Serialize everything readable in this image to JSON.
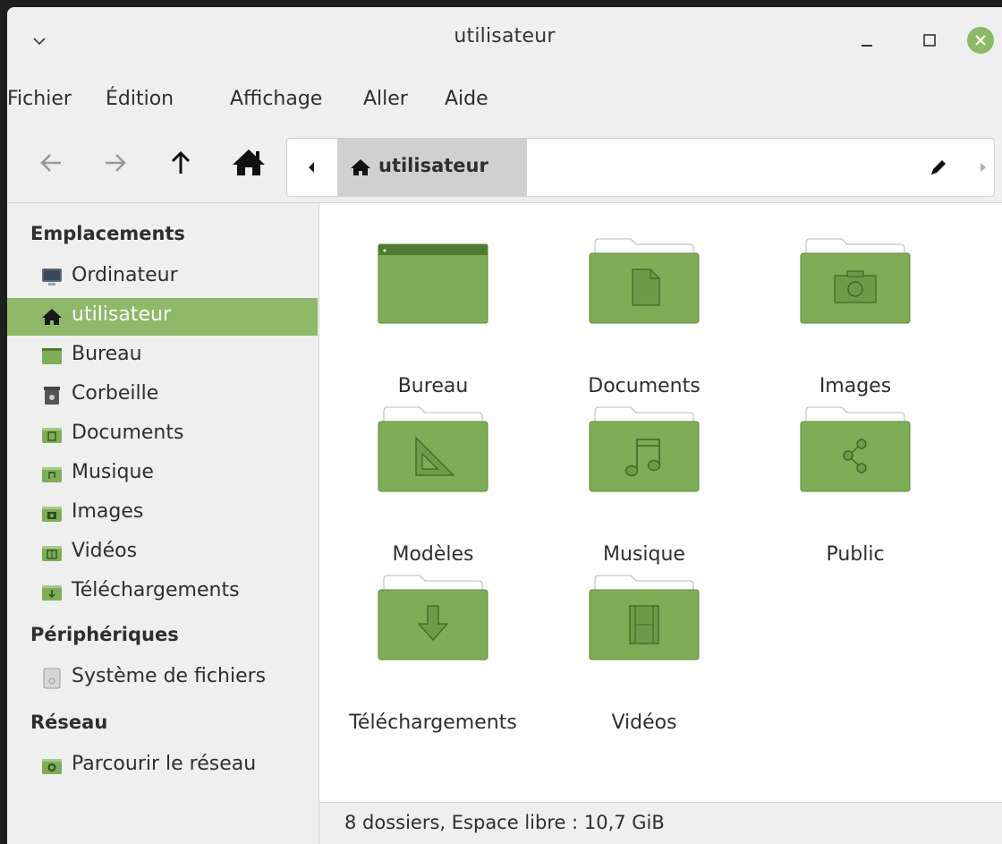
{
  "window": {
    "title": "utilisateur"
  },
  "menubar": {
    "items": [
      {
        "label": "Fichier"
      },
      {
        "label": "Édition"
      },
      {
        "label": "Affichage"
      },
      {
        "label": "Aller"
      },
      {
        "label": "Aide"
      }
    ]
  },
  "toolbar": {
    "back_icon": "arrow-left-icon",
    "forward_icon": "arrow-right-icon",
    "up_icon": "arrow-up-icon",
    "home_icon": "home-icon",
    "path": {
      "crumb_label": "utilisateur",
      "crumb_icon": "home-icon",
      "edit_icon": "pencil-icon"
    }
  },
  "sidebar": {
    "sections": [
      {
        "heading": "Emplacements"
      },
      {
        "heading": "Périphériques"
      },
      {
        "heading": "Réseau"
      }
    ],
    "items": [
      {
        "label": "Ordinateur",
        "icon": "computer-icon"
      },
      {
        "label": "utilisateur",
        "icon": "home-icon",
        "selected": true
      },
      {
        "label": "Bureau",
        "icon": "desktop-folder-icon"
      },
      {
        "label": "Corbeille",
        "icon": "trash-icon"
      },
      {
        "label": "Documents",
        "icon": "documents-folder-icon"
      },
      {
        "label": "Musique",
        "icon": "music-folder-icon"
      },
      {
        "label": "Images",
        "icon": "pictures-folder-icon"
      },
      {
        "label": "Vidéos",
        "icon": "videos-folder-icon"
      },
      {
        "label": "Téléchargements",
        "icon": "downloads-folder-icon"
      },
      {
        "label": "Système de fichiers",
        "icon": "drive-icon"
      },
      {
        "label": "Parcourir le réseau",
        "icon": "network-folder-icon"
      }
    ]
  },
  "main": {
    "folders": [
      {
        "label": "Bureau",
        "icon": "desktop-folder-icon"
      },
      {
        "label": "Documents",
        "icon": "documents-folder-icon"
      },
      {
        "label": "Images",
        "icon": "pictures-folder-icon"
      },
      {
        "label": "Modèles",
        "icon": "templates-folder-icon"
      },
      {
        "label": "Musique",
        "icon": "music-folder-icon"
      },
      {
        "label": "Public",
        "icon": "public-share-folder-icon"
      },
      {
        "label": "Téléchargements",
        "icon": "downloads-folder-icon"
      },
      {
        "label": "Vidéos",
        "icon": "videos-folder-icon"
      }
    ]
  },
  "statusbar": {
    "text": "8 dossiers, Espace libre : 10,7 GiB"
  },
  "colors": {
    "accent": "#8fb868",
    "folder_fill": "#7fad57",
    "folder_dark": "#5d8a3a"
  }
}
